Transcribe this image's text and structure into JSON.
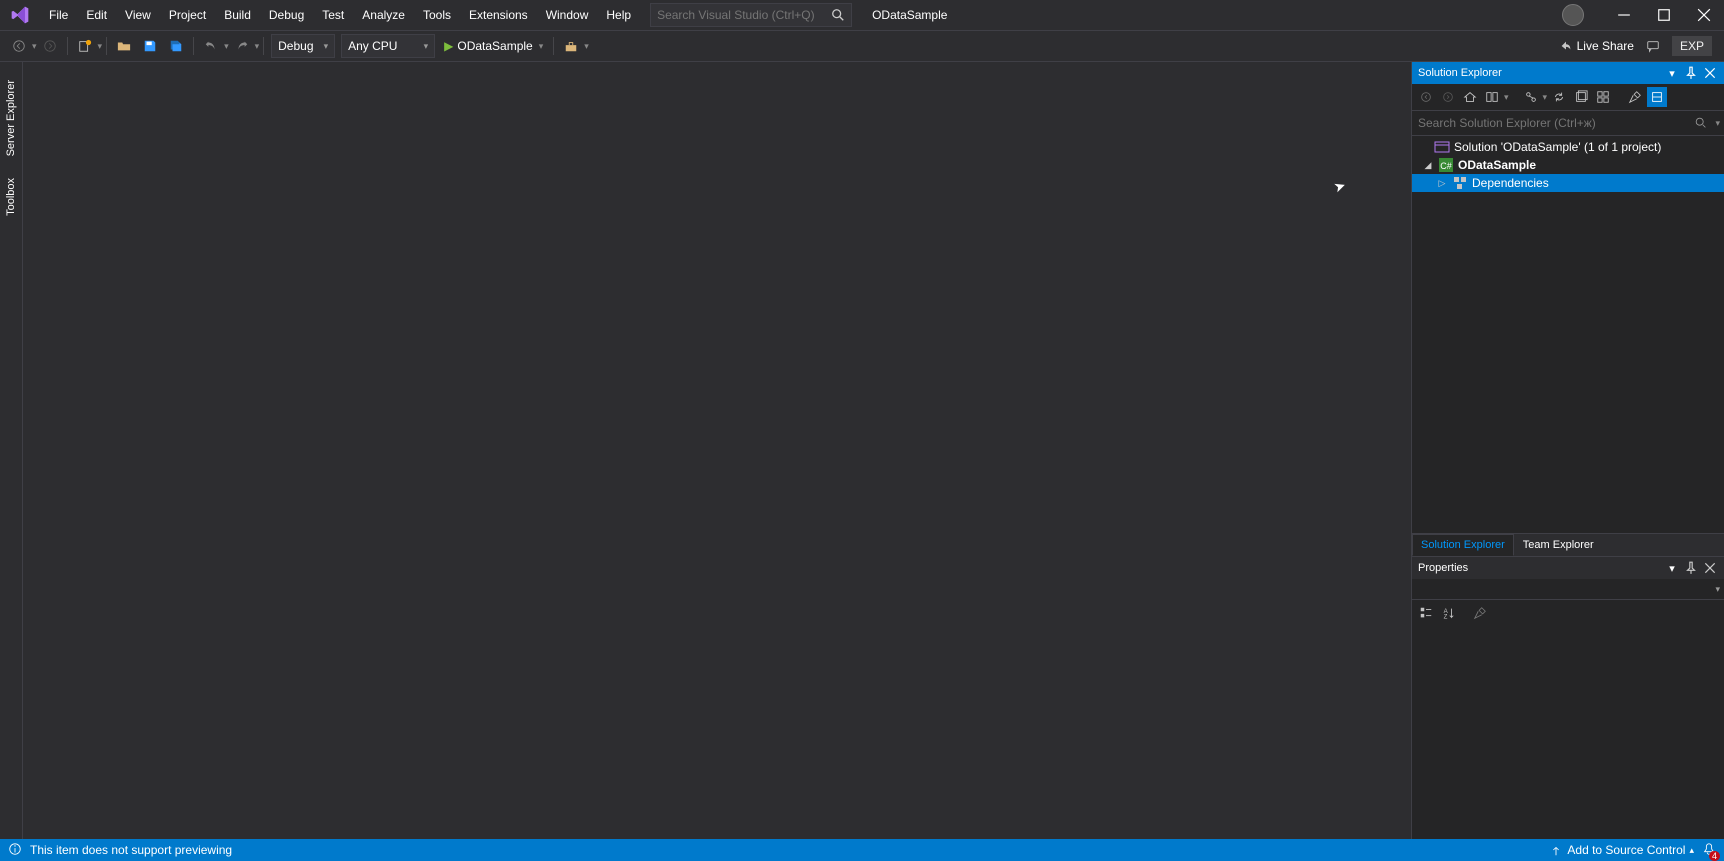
{
  "menu": [
    "File",
    "Edit",
    "View",
    "Project",
    "Build",
    "Debug",
    "Test",
    "Analyze",
    "Tools",
    "Extensions",
    "Window",
    "Help"
  ],
  "search_placeholder": "Search Visual Studio (Ctrl+Q)",
  "app_title": "ODataSample",
  "toolbar": {
    "config": "Debug",
    "platform": "Any CPU",
    "startup": "ODataSample",
    "live_share": "Live Share",
    "exp": "EXP"
  },
  "side_tabs": [
    "Server Explorer",
    "Toolbox"
  ],
  "solution_explorer": {
    "title": "Solution Explorer",
    "search_placeholder": "Search Solution Explorer (Ctrl+ж)",
    "solution_line": "Solution 'ODataSample' (1 of 1 project)",
    "project": "ODataSample",
    "dependencies": "Dependencies"
  },
  "panel_tabs": {
    "active": "Solution Explorer",
    "other": "Team Explorer"
  },
  "properties": {
    "title": "Properties"
  },
  "status": {
    "preview_msg": "This item does not support previewing",
    "source_control": "Add to Source Control",
    "bell_count": "4"
  }
}
